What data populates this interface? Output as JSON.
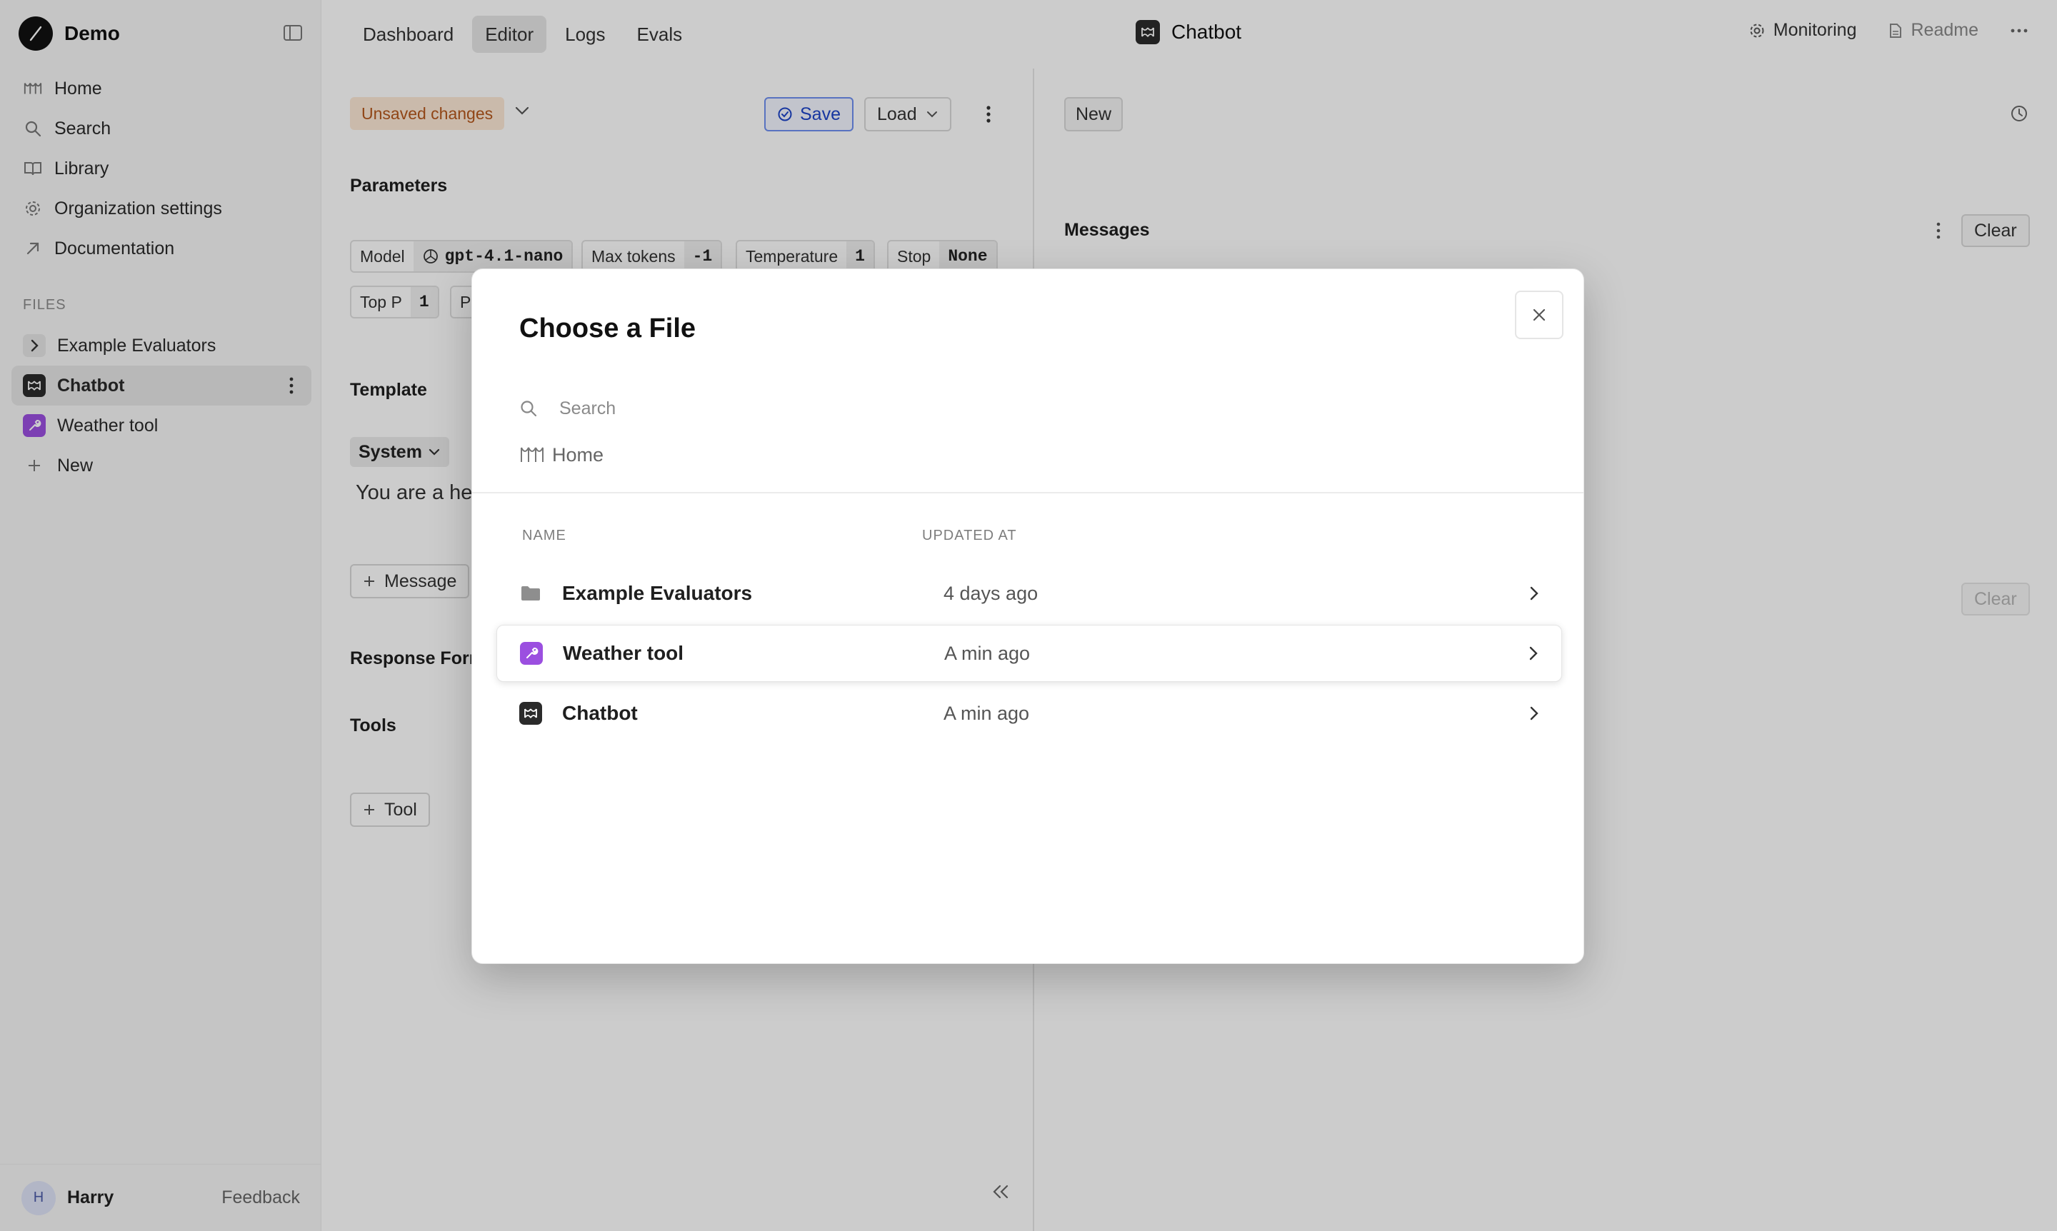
{
  "app": {
    "name": "Demo"
  },
  "nav": [
    {
      "label": "Home",
      "icon": "home-icon"
    },
    {
      "label": "Search",
      "icon": "search-icon"
    },
    {
      "label": "Library",
      "icon": "book-icon"
    },
    {
      "label": "Organization settings",
      "icon": "gear-icon"
    },
    {
      "label": "Documentation",
      "icon": "external-link-icon"
    }
  ],
  "files": {
    "heading": "FILES",
    "items": [
      {
        "label": "Example Evaluators",
        "icon": "chevron-right-icon"
      },
      {
        "label": "Chatbot",
        "icon": "prompt-icon"
      },
      {
        "label": "Weather tool",
        "icon": "wrench-icon"
      },
      {
        "label": "New",
        "icon": "plus-icon"
      }
    ]
  },
  "user": {
    "initial": "H",
    "name": "Harry",
    "feedback": "Feedback"
  },
  "topbar": {
    "tabs": [
      "Dashboard",
      "Editor",
      "Logs",
      "Evals"
    ],
    "active_tab": "Editor",
    "title": "Chatbot",
    "monitoring": "Monitoring",
    "readme": "Readme"
  },
  "editor": {
    "unsaved": "Unsaved changes",
    "save": "Save",
    "load": "Load",
    "parameters_title": "Parameters",
    "params": {
      "model_label": "Model",
      "model_value": "gpt-4.1-nano",
      "max_tokens_label": "Max tokens",
      "max_tokens_value": "-1",
      "temperature_label": "Temperature",
      "temperature_value": "1",
      "stop_label": "Stop",
      "stop_value": "None",
      "top_p_label": "Top P",
      "top_p_value": "1",
      "p_label": "P"
    },
    "template_title": "Template",
    "system_role": "System",
    "template_text": "You are a he",
    "add_message": "Message",
    "response_format_title": "Response Form",
    "tools_title": "Tools",
    "add_tool": "Tool"
  },
  "right": {
    "new": "New",
    "messages_title": "Messages",
    "clear": "Clear",
    "clear_second": "Clear"
  },
  "modal": {
    "title": "Choose a File",
    "search_placeholder": "Search",
    "breadcrumb": "Home",
    "col_name": "NAME",
    "col_updated": "UPDATED AT",
    "rows": [
      {
        "name": "Example Evaluators",
        "updated": "4 days ago",
        "icon": "folder-icon"
      },
      {
        "name": "Weather tool",
        "updated": "A min ago",
        "icon": "wrench-icon"
      },
      {
        "name": "Chatbot",
        "updated": "A min ago",
        "icon": "prompt-icon"
      }
    ]
  },
  "colors": {
    "accent_blue": "#1d44c9",
    "tool_purple": "#9b4fe0",
    "unsaved_bg": "#fde9d6",
    "unsaved_text": "#b4571c"
  }
}
